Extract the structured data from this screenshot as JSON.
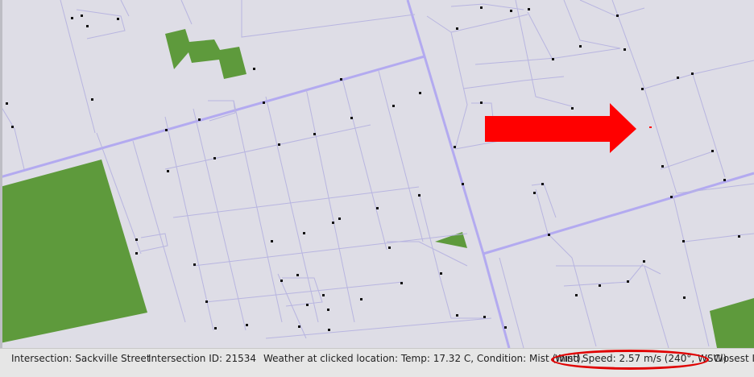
{
  "status_bar": {
    "intersection": "Intersection: Sackville Street",
    "intersection_id": "Intersection ID: 21534",
    "weather": "Weather at clicked location: Temp: 17.32 C, Condition: Mist (mist),",
    "wind": "Wind Speed: 2.57 m/s (240°, WSW)",
    "closest": "Closest I"
  },
  "colors": {
    "background": "#dedde6",
    "minor_street": "#b8b5e0",
    "major_street": "#b3aaf0",
    "park": "#5e9a3c",
    "intersection_dot": "#111111",
    "arrow": "#ff0000",
    "highlight_ring": "#e00000"
  },
  "annotations": {
    "arrow_icon": "right-arrow-icon",
    "highlight": "red-ellipse-around-wind-speed"
  }
}
